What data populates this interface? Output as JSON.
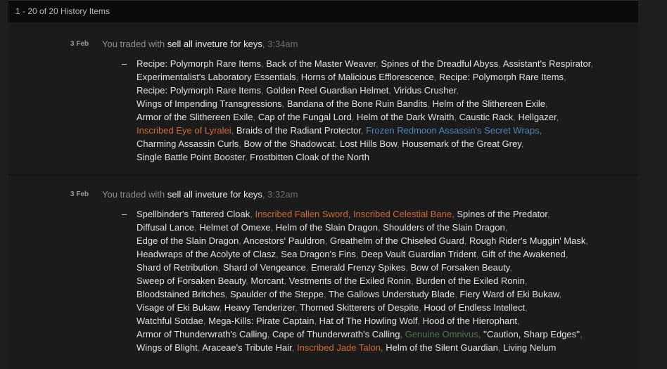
{
  "header": {
    "summary": "1 - 20 of 20 History Items"
  },
  "colors": {
    "background": "#1e1e1e",
    "panel": "#1b1b1b",
    "topbar": "#0b0b0b",
    "plain": "#e2e2e2",
    "inscribed": "#cf6a32",
    "corrupted_blue": "#4f86b8",
    "genuine": "#4d7455"
  },
  "entries": [
    {
      "date": "3 Feb",
      "prefix": "You traded with",
      "partner": "sell all inveture for keys",
      "time": "3:34am",
      "dash": "–",
      "lines": [
        [
          {
            "name": "Recipe: Polymorph Rare Items",
            "style": "plain"
          },
          {
            "name": "Back of the Master Weaver",
            "style": "plain"
          },
          {
            "name": "Spines of the Dreadful Abyss",
            "style": "plain"
          },
          {
            "name": "Assistant's Respirator",
            "style": "plain"
          }
        ],
        [
          {
            "name": "Experimentalist's Laboratory Essentials",
            "style": "plain"
          },
          {
            "name": "Horns of Malicious Efflorescence",
            "style": "plain"
          },
          {
            "name": "Recipe: Polymorph Rare Items",
            "style": "plain"
          }
        ],
        [
          {
            "name": "Recipe: Polymorph Rare Items",
            "style": "plain"
          },
          {
            "name": "Golden Reel Guardian Helmet",
            "style": "plain"
          },
          {
            "name": "Viridus Crusher",
            "style": "plain"
          }
        ],
        [
          {
            "name": "Wings of Impending Transgressions",
            "style": "plain"
          },
          {
            "name": "Bandana of the Bone Ruin Bandits",
            "style": "plain"
          },
          {
            "name": "Helm of the Slithereen Exile",
            "style": "plain"
          }
        ],
        [
          {
            "name": "Armor of the Slithereen Exile",
            "style": "plain"
          },
          {
            "name": "Cap of the Fungal Lord",
            "style": "plain"
          },
          {
            "name": "Helm of the Dark Wraith",
            "style": "plain"
          },
          {
            "name": "Caustic Rack",
            "style": "plain"
          },
          {
            "name": "Hellgazer",
            "style": "plain"
          }
        ],
        [
          {
            "name": "Inscribed Eye of Lyralei",
            "style": "inscribed"
          },
          {
            "name": "Braids of the Radiant Protector",
            "style": "plain"
          },
          {
            "name": "Frozen Redmoon Assassin's Secret Wraps",
            "style": "corrupted"
          }
        ],
        [
          {
            "name": "Charming Assassin Curls",
            "style": "plain"
          },
          {
            "name": "Bow of the Shadowcat",
            "style": "plain"
          },
          {
            "name": "Lost Hills Bow",
            "style": "plain"
          },
          {
            "name": "Housemark of the Great Grey",
            "style": "plain"
          }
        ],
        [
          {
            "name": "Single Battle Point Booster",
            "style": "plain"
          },
          {
            "name": "Frostbitten Cloak of the North",
            "style": "plain"
          }
        ]
      ]
    },
    {
      "date": "3 Feb",
      "prefix": "You traded with",
      "partner": "sell all inveture for keys",
      "time": "3:32am",
      "dash": "–",
      "lines": [
        [
          {
            "name": "Spellbinder's Tattered Cloak",
            "style": "plain"
          },
          {
            "name": "Inscribed Fallen Sword",
            "style": "inscribed"
          },
          {
            "name": "Inscribed Celestial Bane",
            "style": "inscribed"
          },
          {
            "name": "Spines of the Predator",
            "style": "plain"
          }
        ],
        [
          {
            "name": "Diffusal Lance",
            "style": "plain"
          },
          {
            "name": "Helmet of Omexe",
            "style": "plain"
          },
          {
            "name": "Helm of the Slain Dragon",
            "style": "plain"
          },
          {
            "name": "Shoulders of the Slain Dragon",
            "style": "plain"
          }
        ],
        [
          {
            "name": "Edge of the Slain Dragon",
            "style": "plain"
          },
          {
            "name": "Ancestors' Pauldron",
            "style": "plain"
          },
          {
            "name": "Greathelm of the Chiseled Guard",
            "style": "plain"
          },
          {
            "name": "Rough Rider's Muggin' Mask",
            "style": "plain"
          }
        ],
        [
          {
            "name": "Headwraps of the Acolyte of Clasz",
            "style": "plain"
          },
          {
            "name": "Sea Dragon's Fins",
            "style": "plain"
          },
          {
            "name": "Deep Vault Guardian Trident",
            "style": "plain"
          },
          {
            "name": "Gift of the Awakened",
            "style": "plain"
          }
        ],
        [
          {
            "name": "Shard of Retribution",
            "style": "plain"
          },
          {
            "name": "Shard of Vengeance",
            "style": "plain"
          },
          {
            "name": "Emerald Frenzy Spikes",
            "style": "plain"
          },
          {
            "name": "Bow of Forsaken Beauty",
            "style": "plain"
          }
        ],
        [
          {
            "name": "Sweep of Forsaken Beauty",
            "style": "plain"
          },
          {
            "name": "Morcant",
            "style": "plain"
          },
          {
            "name": "Vestments of the Exiled Ronin",
            "style": "plain"
          },
          {
            "name": "Burden of the Exiled Ronin",
            "style": "plain"
          }
        ],
        [
          {
            "name": "Bloodstained Britches",
            "style": "plain"
          },
          {
            "name": "Spaulder of the Steppe",
            "style": "plain"
          },
          {
            "name": "The Gallows Understudy Blade",
            "style": "plain"
          },
          {
            "name": "Fiery Ward of Eki Bukaw",
            "style": "plain"
          }
        ],
        [
          {
            "name": "Visage of Eki Bukaw",
            "style": "plain"
          },
          {
            "name": "Heavy Tenderizer",
            "style": "plain"
          },
          {
            "name": "Thorned Skitterers of Despite",
            "style": "plain"
          },
          {
            "name": "Hood of Endless Intellect",
            "style": "plain"
          }
        ],
        [
          {
            "name": "Watchful Sotdae",
            "style": "plain"
          },
          {
            "name": "Mega-Kills: Pirate Captain",
            "style": "plain"
          },
          {
            "name": "Hat of The Howling Wolf",
            "style": "plain"
          },
          {
            "name": "Hood of the Hierophant",
            "style": "plain"
          }
        ],
        [
          {
            "name": "Armor of Thunderwrath's Calling",
            "style": "plain"
          },
          {
            "name": "Cape of Thunderwrath's Calling",
            "style": "plain"
          },
          {
            "name": "Genuine Omnivus",
            "style": "genuine"
          },
          {
            "name": "''Caution, Sharp Edges''",
            "style": "plain"
          }
        ],
        [
          {
            "name": "Wings of Blight",
            "style": "plain"
          },
          {
            "name": "Araceae's Tribute Hair",
            "style": "plain"
          },
          {
            "name": "Inscribed Jade Talon",
            "style": "inscribed"
          },
          {
            "name": "Helm of the Silent Guardian",
            "style": "plain"
          },
          {
            "name": "Living Nelum",
            "style": "plain"
          }
        ]
      ]
    }
  ]
}
